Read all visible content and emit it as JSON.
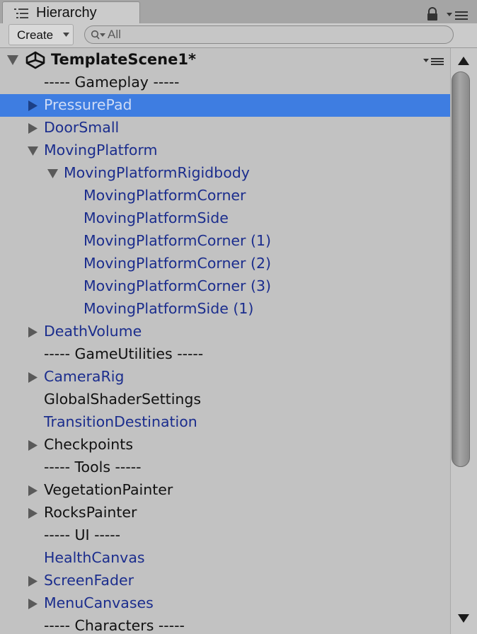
{
  "tab": {
    "title": "Hierarchy",
    "icon": "list-icon"
  },
  "toolbar": {
    "create_label": "Create",
    "search_placeholder": "All"
  },
  "scene": {
    "title": "TemplateScene1*"
  },
  "colors": {
    "selection": "#3e7de1",
    "prefab_text": "#1b2d8d",
    "normal_text": "#111111",
    "background": "#c2c2c2"
  },
  "rows": [
    {
      "label": "----- Gameplay -----",
      "depth": 0,
      "fold": "none",
      "style": "black"
    },
    {
      "label": "PressurePad",
      "depth": 0,
      "fold": "collapsed",
      "style": "selected"
    },
    {
      "label": "DoorSmall",
      "depth": 0,
      "fold": "collapsed",
      "style": "blue"
    },
    {
      "label": "MovingPlatform",
      "depth": 0,
      "fold": "expanded",
      "style": "blue"
    },
    {
      "label": "MovingPlatformRigidbody",
      "depth": 1,
      "fold": "expanded",
      "style": "blue"
    },
    {
      "label": "MovingPlatformCorner",
      "depth": 2,
      "fold": "none",
      "style": "blue"
    },
    {
      "label": "MovingPlatformSide",
      "depth": 2,
      "fold": "none",
      "style": "blue"
    },
    {
      "label": "MovingPlatformCorner (1)",
      "depth": 2,
      "fold": "none",
      "style": "blue"
    },
    {
      "label": "MovingPlatformCorner (2)",
      "depth": 2,
      "fold": "none",
      "style": "blue"
    },
    {
      "label": "MovingPlatformCorner (3)",
      "depth": 2,
      "fold": "none",
      "style": "blue"
    },
    {
      "label": "MovingPlatformSide (1)",
      "depth": 2,
      "fold": "none",
      "style": "blue"
    },
    {
      "label": "DeathVolume",
      "depth": 0,
      "fold": "collapsed",
      "style": "blue"
    },
    {
      "label": "----- GameUtilities -----",
      "depth": 0,
      "fold": "none",
      "style": "black"
    },
    {
      "label": "CameraRig",
      "depth": 0,
      "fold": "collapsed",
      "style": "blue"
    },
    {
      "label": "GlobalShaderSettings",
      "depth": 0,
      "fold": "none",
      "style": "black"
    },
    {
      "label": "TransitionDestination",
      "depth": 0,
      "fold": "none",
      "style": "blue"
    },
    {
      "label": "Checkpoints",
      "depth": 0,
      "fold": "collapsed",
      "style": "black"
    },
    {
      "label": "----- Tools -----",
      "depth": 0,
      "fold": "none",
      "style": "black"
    },
    {
      "label": "VegetationPainter",
      "depth": 0,
      "fold": "collapsed",
      "style": "black"
    },
    {
      "label": "RocksPainter",
      "depth": 0,
      "fold": "collapsed",
      "style": "black"
    },
    {
      "label": "----- UI -----",
      "depth": 0,
      "fold": "none",
      "style": "black"
    },
    {
      "label": "HealthCanvas",
      "depth": 0,
      "fold": "none",
      "style": "blue"
    },
    {
      "label": "ScreenFader",
      "depth": 0,
      "fold": "collapsed",
      "style": "blue"
    },
    {
      "label": "MenuCanvases",
      "depth": 0,
      "fold": "collapsed",
      "style": "blue"
    },
    {
      "label": "----- Characters -----",
      "depth": 0,
      "fold": "none",
      "style": "black"
    }
  ],
  "scroll": {
    "position_fraction": 0.0,
    "visible_fraction": 0.75
  }
}
